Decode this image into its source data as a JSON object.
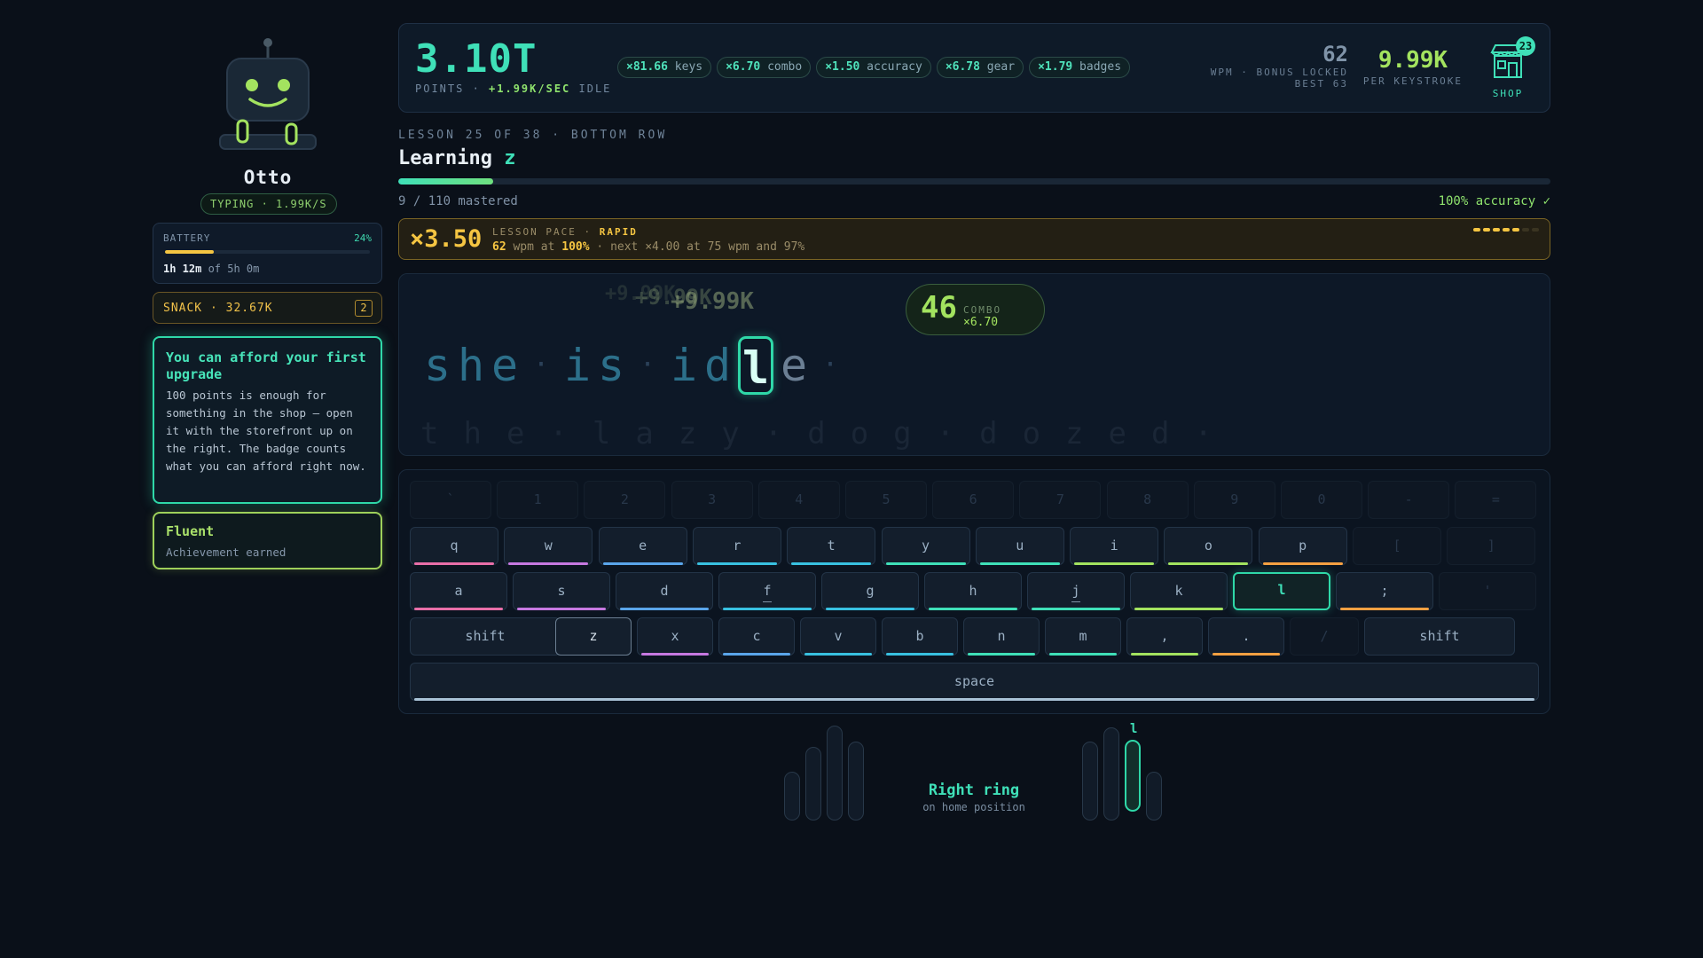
{
  "bot": {
    "name": "Otto",
    "typing_rate": "TYPING · 1.99K/S",
    "battery_label": "BATTERY",
    "battery_percent": "24%",
    "battery_fraction": 0.24,
    "battery_time": "1h 12m",
    "battery_of": " of 5h 0m"
  },
  "snack": {
    "label": "SNACK · 32.67K",
    "count": "2"
  },
  "tip": {
    "title": "You can afford your first upgrade",
    "body": "100 points is enough for something in the shop — open it with the storefront up on the right. The badge counts what you can afford right now."
  },
  "achievement": {
    "title": "Fluent",
    "subtitle": "Achievement earned"
  },
  "stats": {
    "points": "3.10T",
    "points_label": "POINTS · ",
    "rate": "+1.99K/SEC",
    "idle": " IDLE",
    "multipliers": [
      {
        "value": "×81.66",
        "label": " keys"
      },
      {
        "value": "×6.70",
        "label": " combo"
      },
      {
        "value": "×1.50",
        "label": " accuracy"
      },
      {
        "value": "×6.78",
        "label": " gear"
      },
      {
        "value": "×1.79",
        "label": " badges"
      }
    ],
    "wpm": "62",
    "wpm_label": "WPM · BONUS LOCKED",
    "wpm_best": "BEST 63",
    "per_key": "9.99K",
    "per_key_label": "PER KEYSTROKE",
    "shop_label": "SHOP",
    "shop_badge": "23"
  },
  "lesson": {
    "eyebrow": "LESSON 25 OF 38 · BOTTOM ROW",
    "title_prefix": "Learning ",
    "title_key": "z",
    "progress": 0.082,
    "mastered": "9 / 110 mastered",
    "accuracy": "100% accuracy ✓"
  },
  "pace": {
    "multiplier": "×3.50",
    "label": "LESSON PACE · ",
    "rating": "RAPID",
    "wpm": "62",
    "wpm_text": " wpm at ",
    "acc": "100%",
    "next": " · next ×4.00 at 75 wpm and 97%",
    "segments_filled": 5,
    "segments_total": 7
  },
  "typing": {
    "floats": [
      "+9.99K",
      "+9.99K",
      "+9.99K"
    ],
    "combo": "46",
    "combo_label": "COMBO",
    "combo_mult": "×6.70",
    "current_done": "she is id",
    "current_char": "l",
    "current_rest": "e ",
    "next_line": "the lazy dog dozed "
  },
  "keyboard": {
    "number_row": [
      "`",
      "1",
      "2",
      "3",
      "4",
      "5",
      "6",
      "7",
      "8",
      "9",
      "0",
      "-",
      "="
    ],
    "top_row": [
      "q",
      "w",
      "e",
      "r",
      "t",
      "y",
      "u",
      "i",
      "o",
      "p",
      "[",
      "]"
    ],
    "home_row": [
      "a",
      "s",
      "d",
      "f",
      "g",
      "h",
      "j",
      "k",
      "l",
      ";",
      "'"
    ],
    "bottom_row": [
      "shift",
      "z",
      "x",
      "c",
      "v",
      "b",
      "n",
      "m",
      ",",
      ".",
      "/",
      "shift"
    ],
    "space": "space",
    "active_key": "l",
    "target_key": "z",
    "finger_colors": [
      "#e86ea8",
      "#c678e0",
      "#5aa5ea",
      "#38c0e0",
      "#3fe0b8",
      "#a3e35f",
      "#f5a042"
    ]
  },
  "hands": {
    "active_key": "l",
    "finger": "Right ring",
    "position": "on home position"
  }
}
